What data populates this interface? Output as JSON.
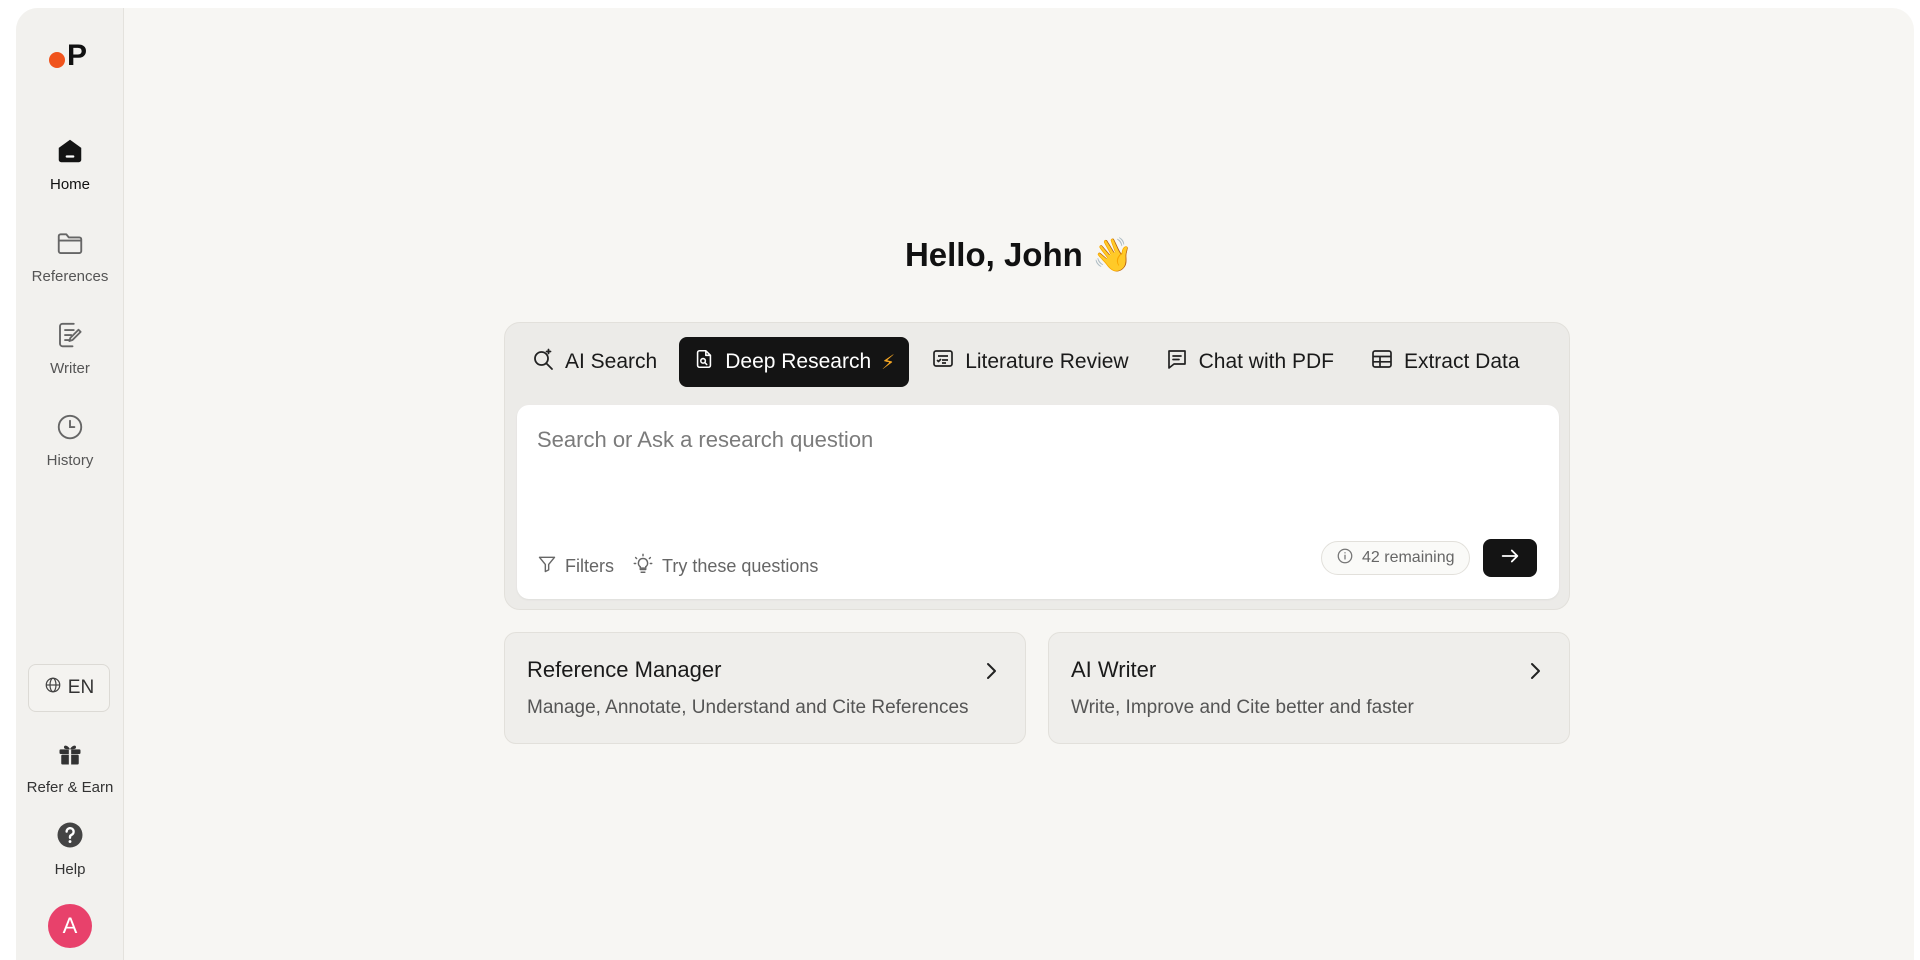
{
  "app": {
    "logo_letter": "P"
  },
  "sidebar": {
    "items": [
      {
        "label": "Home",
        "icon": "home-icon",
        "active": true
      },
      {
        "label": "References",
        "icon": "folder-icon",
        "active": false
      },
      {
        "label": "Writer",
        "icon": "writer-icon",
        "active": false
      },
      {
        "label": "History",
        "icon": "clock-icon",
        "active": false
      }
    ],
    "language": "EN",
    "refer_label": "Refer & Earn",
    "help_label": "Help",
    "avatar_initial": "A"
  },
  "main": {
    "greeting": "Hello, John 👋",
    "tabs": [
      {
        "label": "AI Search",
        "icon": "ai-search-icon",
        "active": false
      },
      {
        "label": "Deep Research",
        "icon": "document-icon",
        "active": true,
        "badge": "⚡"
      },
      {
        "label": "Literature Review",
        "icon": "literature-review-icon",
        "active": false
      },
      {
        "label": "Chat with PDF",
        "icon": "chat-icon",
        "active": false
      },
      {
        "label": "Extract Data",
        "icon": "table-icon",
        "active": false
      }
    ],
    "search": {
      "placeholder": "Search or Ask a research question",
      "value": "",
      "filters_label": "Filters",
      "try_label": "Try these questions",
      "remaining": "42 remaining"
    },
    "cards": [
      {
        "title": "Reference Manager",
        "description": "Manage, Annotate, Understand and Cite References"
      },
      {
        "title": "AI Writer",
        "description": "Write, Improve and Cite better and faster"
      }
    ]
  },
  "colors": {
    "accent_dark": "#141414",
    "logo_dot": "#f0531c",
    "avatar_bg": "#e8416b",
    "bolt": "#f5a623"
  }
}
